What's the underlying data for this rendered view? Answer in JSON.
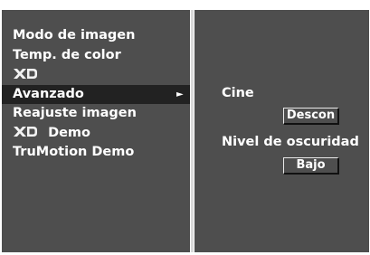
{
  "menu": {
    "items": [
      {
        "label": "Modo de imagen"
      },
      {
        "label": "Temp. de color"
      },
      {
        "label": "",
        "icon": "xd-logo-icon"
      },
      {
        "label": "Avanzado",
        "selected": true,
        "arrow": "►"
      },
      {
        "label": "Reajuste imagen"
      },
      {
        "label": "Demo",
        "icon": "xd-logo-icon"
      },
      {
        "label": "TruMotion Demo"
      }
    ]
  },
  "submenu": {
    "cine_label": "Cine",
    "cine_value": "Descon",
    "dark_label": "Nivel de oscuridad",
    "dark_value": "Bajo"
  },
  "logo": {
    "xd_text": "XD"
  },
  "colors": {
    "panel": "#4e4e4e",
    "selected_row": "#222222",
    "divider": "#d9d9d9",
    "text": "#ffffff"
  }
}
